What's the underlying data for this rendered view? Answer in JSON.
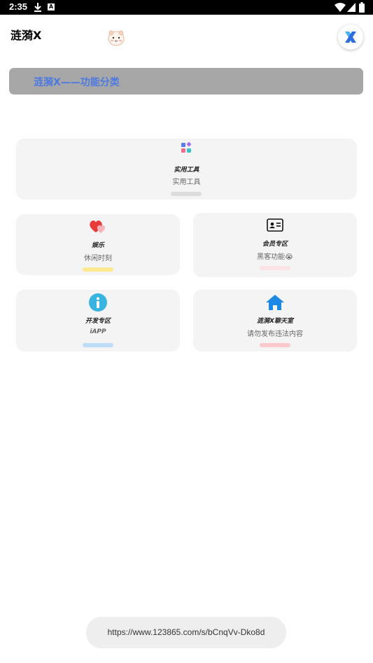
{
  "status_bar": {
    "time": "2:35",
    "download_icon": "download-icon",
    "notification_icon": "a-notification-icon",
    "wifi_icon": "wifi-icon",
    "signal_icon": "signal-icon",
    "battery_icon": "battery-icon"
  },
  "header": {
    "title": "涟漪X",
    "mascot_icon": "hamster-sticker-icon",
    "logo_icon": "x-logo-icon"
  },
  "banner": {
    "text": "涟漪X——功能分类"
  },
  "cards": [
    {
      "title": "实用工具",
      "subtitle": "实用工具",
      "icon": "apps-icon",
      "bar_color": "#dcdcdc"
    },
    {
      "title": "娱乐",
      "subtitle": "休闲时刻",
      "icon": "hearts-icon",
      "bar_color": "#fde98f"
    },
    {
      "title": "会员专区",
      "subtitle": "黑客功能😭",
      "icon": "id-card-icon",
      "bar_color": "#fbe2e6"
    },
    {
      "title": "开发专区",
      "subtitle": "iAPP",
      "icon": "info-icon",
      "bar_color": "#bcdcf7"
    },
    {
      "title": "涟漪X聊天室",
      "subtitle": "请勿发布违法内容",
      "icon": "home-icon",
      "bar_color": "#fbc9cc"
    }
  ],
  "url_toast": {
    "text": "https://www.123865.com/s/bCnqVv-Dko8d"
  }
}
